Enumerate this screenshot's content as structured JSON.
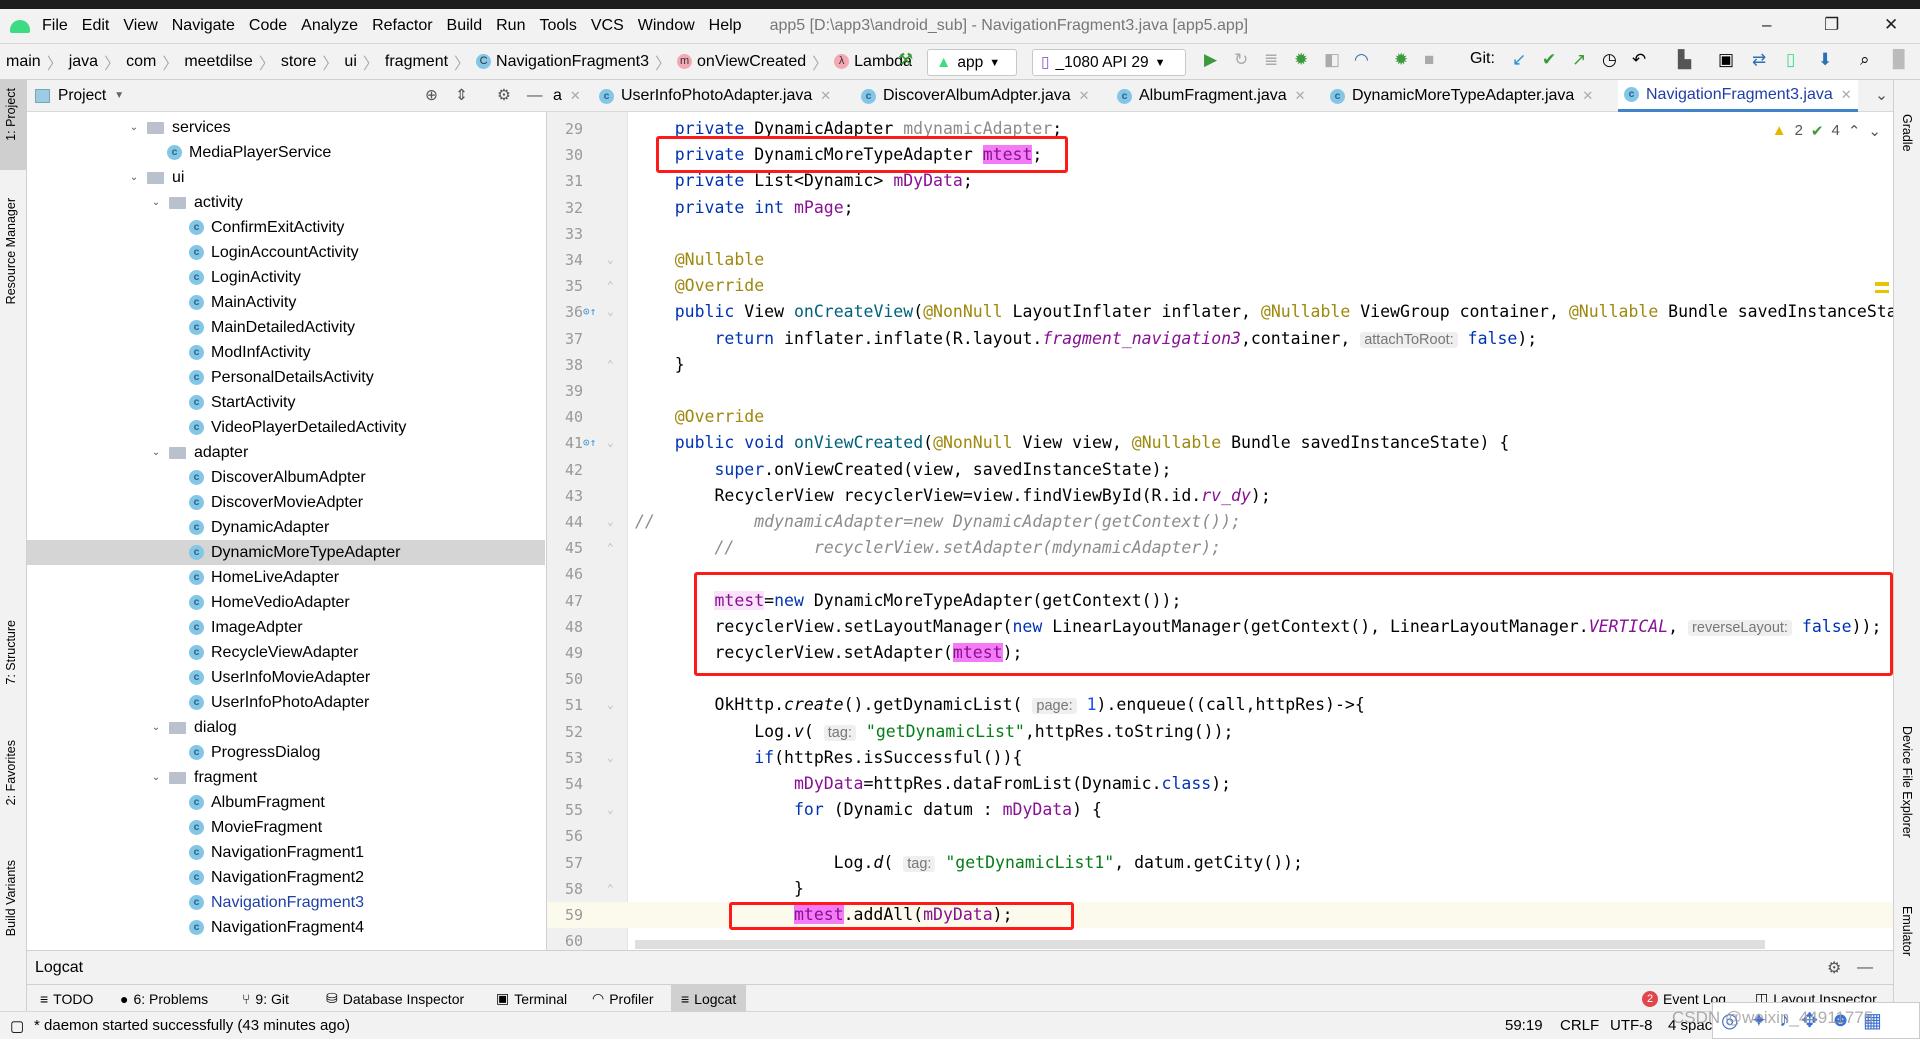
{
  "window": {
    "title": "app5 [D:\\app3\\android_sub] - NavigationFragment3.java [app5.app]",
    "minimize": "–",
    "maximize": "❐",
    "close": "✕"
  },
  "menu": [
    "File",
    "Edit",
    "View",
    "Navigate",
    "Code",
    "Analyze",
    "Refactor",
    "Build",
    "Run",
    "Tools",
    "VCS",
    "Window",
    "Help"
  ],
  "breadcrumb": [
    {
      "label": "main"
    },
    {
      "label": "java"
    },
    {
      "label": "com"
    },
    {
      "label": "meetdilse"
    },
    {
      "label": "store"
    },
    {
      "label": "ui"
    },
    {
      "label": "fragment"
    },
    {
      "label": "NavigationFragment3",
      "icon": "C"
    },
    {
      "label": "onViewCreated",
      "icon": "m"
    },
    {
      "label": "Lambda",
      "icon": "λ"
    }
  ],
  "toolbar": {
    "run_config": "app",
    "device": "_1080 API 29",
    "git_label": "Git:"
  },
  "left_strip": [
    "1: Project",
    "Resource Manager",
    "7: Structure",
    "2: Favorites",
    "Build Variants"
  ],
  "right_strip": [
    "Gradle",
    "Device File Explorer",
    "Emulator"
  ],
  "project": {
    "title": "Project",
    "tree": [
      {
        "label": "services",
        "depth": 0,
        "type": "folder"
      },
      {
        "label": "MediaPlayerService",
        "depth": 1,
        "type": "class"
      },
      {
        "label": "ui",
        "depth": 0,
        "type": "folder"
      },
      {
        "label": "activity",
        "depth": 1,
        "type": "folder"
      },
      {
        "label": "ConfirmExitActivity",
        "depth": 2,
        "type": "class"
      },
      {
        "label": "LoginAccountActivity",
        "depth": 2,
        "type": "class"
      },
      {
        "label": "LoginActivity",
        "depth": 2,
        "type": "class"
      },
      {
        "label": "MainActivity",
        "depth": 2,
        "type": "class"
      },
      {
        "label": "MainDetailedActivity",
        "depth": 2,
        "type": "class"
      },
      {
        "label": "ModInfActivity",
        "depth": 2,
        "type": "class"
      },
      {
        "label": "PersonalDetailsActivity",
        "depth": 2,
        "type": "class"
      },
      {
        "label": "StartActivity",
        "depth": 2,
        "type": "class"
      },
      {
        "label": "VideoPlayerDetailedActivity",
        "depth": 2,
        "type": "class"
      },
      {
        "label": "adapter",
        "depth": 1,
        "type": "folder"
      },
      {
        "label": "DiscoverAlbumAdpter",
        "depth": 2,
        "type": "class"
      },
      {
        "label": "DiscoverMovieAdpter",
        "depth": 2,
        "type": "class"
      },
      {
        "label": "DynamicAdapter",
        "depth": 2,
        "type": "class"
      },
      {
        "label": "DynamicMoreTypeAdapter",
        "depth": 2,
        "type": "class",
        "selected": true
      },
      {
        "label": "HomeLiveAdapter",
        "depth": 2,
        "type": "class"
      },
      {
        "label": "HomeVedioAdapter",
        "depth": 2,
        "type": "class"
      },
      {
        "label": "ImageAdpter",
        "depth": 2,
        "type": "class"
      },
      {
        "label": "RecycleViewAdapter",
        "depth": 2,
        "type": "class"
      },
      {
        "label": "UserInfoMovieAdapter",
        "depth": 2,
        "type": "class"
      },
      {
        "label": "UserInfoPhotoAdapter",
        "depth": 2,
        "type": "class"
      },
      {
        "label": "dialog",
        "depth": 1,
        "type": "folder"
      },
      {
        "label": "ProgressDialog",
        "depth": 2,
        "type": "class"
      },
      {
        "label": "fragment",
        "depth": 1,
        "type": "folder"
      },
      {
        "label": "AlbumFragment",
        "depth": 2,
        "type": "class"
      },
      {
        "label": "MovieFragment",
        "depth": 2,
        "type": "class"
      },
      {
        "label": "NavigationFragment1",
        "depth": 2,
        "type": "class"
      },
      {
        "label": "NavigationFragment2",
        "depth": 2,
        "type": "class"
      },
      {
        "label": "NavigationFragment3",
        "depth": 2,
        "type": "class",
        "open": true
      },
      {
        "label": "NavigationFragment4",
        "depth": 2,
        "type": "class"
      }
    ]
  },
  "tabs": [
    {
      "label": "a"
    },
    {
      "label": "UserInfoPhotoAdapter.java"
    },
    {
      "label": "DiscoverAlbumAdpter.java"
    },
    {
      "label": "AlbumFragment.java"
    },
    {
      "label": "DynamicMoreTypeAdapter.java"
    },
    {
      "label": "NavigationFragment3.java",
      "active": true
    }
  ],
  "inspections": {
    "warnings": "2",
    "typos": "4"
  },
  "code": [
    {
      "n": "29",
      "t": [
        [
          "",
          "    "
        ],
        [
          "kw",
          "private"
        ],
        [
          "",
          " DynamicAdapter "
        ],
        [
          "gray",
          "mdynamicAdapter"
        ],
        [
          "",
          ";"
        ]
      ]
    },
    {
      "n": "30",
      "t": [
        [
          "",
          "    "
        ],
        [
          "kw",
          "private"
        ],
        [
          "",
          " DynamicMoreTypeAdapter "
        ],
        [
          "hl",
          "mtest"
        ],
        [
          "",
          ";"
        ]
      ]
    },
    {
      "n": "31",
      "t": [
        [
          "",
          "    "
        ],
        [
          "kw",
          "private"
        ],
        [
          "",
          " List<Dynamic> "
        ],
        [
          "fld",
          "mDyData"
        ],
        [
          "",
          ";"
        ]
      ]
    },
    {
      "n": "32",
      "t": [
        [
          "",
          "    "
        ],
        [
          "kw",
          "private"
        ],
        [
          "",
          " "
        ],
        [
          "kw",
          "int"
        ],
        [
          "",
          " "
        ],
        [
          "fld",
          "mPage"
        ],
        [
          "",
          ";"
        ]
      ]
    },
    {
      "n": "33",
      "t": []
    },
    {
      "n": "34",
      "t": [
        [
          "",
          "    "
        ],
        [
          "ann",
          "@Nullable"
        ]
      ]
    },
    {
      "n": "35",
      "t": [
        [
          "",
          "    "
        ],
        [
          "ann",
          "@Override"
        ]
      ]
    },
    {
      "n": "36",
      "t": [
        [
          "",
          "    "
        ],
        [
          "kw",
          "public"
        ],
        [
          "",
          " View "
        ],
        [
          "fn",
          "onCreateView"
        ],
        [
          "",
          "("
        ],
        [
          "ann",
          "@NonNull"
        ],
        [
          "",
          " LayoutInflater inflater, "
        ],
        [
          "ann",
          "@Nullable"
        ],
        [
          "",
          " ViewGroup container, "
        ],
        [
          "ann",
          "@Nullable"
        ],
        [
          "",
          " Bundle savedInstanceState) {"
        ]
      ]
    },
    {
      "n": "37",
      "t": [
        [
          "",
          "        "
        ],
        [
          "kw",
          "return"
        ],
        [
          "",
          " inflater.inflate(R.layout."
        ],
        [
          "sfld",
          "fragment_navigation3"
        ],
        [
          "",
          ",container, "
        ],
        [
          "hint",
          "attachToRoot:"
        ],
        [
          "",
          " "
        ],
        [
          "kw",
          "false"
        ],
        [
          "",
          ");"
        ]
      ]
    },
    {
      "n": "38",
      "t": [
        [
          "",
          "    }"
        ]
      ]
    },
    {
      "n": "39",
      "t": []
    },
    {
      "n": "40",
      "t": [
        [
          "",
          "    "
        ],
        [
          "ann",
          "@Override"
        ]
      ]
    },
    {
      "n": "41",
      "t": [
        [
          "",
          "    "
        ],
        [
          "kw",
          "public"
        ],
        [
          "",
          " "
        ],
        [
          "kw",
          "void"
        ],
        [
          "",
          " "
        ],
        [
          "fn",
          "onViewCreated"
        ],
        [
          "",
          "("
        ],
        [
          "ann",
          "@NonNull"
        ],
        [
          "",
          " View view, "
        ],
        [
          "ann",
          "@Nullable"
        ],
        [
          "",
          " Bundle savedInstanceState) {"
        ]
      ]
    },
    {
      "n": "42",
      "t": [
        [
          "",
          "        "
        ],
        [
          "kw",
          "super"
        ],
        [
          "",
          ".onViewCreated(view, savedInstanceState);"
        ]
      ]
    },
    {
      "n": "43",
      "t": [
        [
          "",
          "        RecyclerView recyclerView=view.findViewById(R.id."
        ],
        [
          "sfld",
          "rv_dy"
        ],
        [
          "",
          ");"
        ]
      ]
    },
    {
      "n": "44",
      "t": [
        [
          "cmt",
          "//          mdynamicAdapter=new DynamicAdapter(getContext());"
        ]
      ]
    },
    {
      "n": "45",
      "t": [
        [
          "",
          "        "
        ],
        [
          "cmt",
          "//        recyclerView.setAdapter(mdynamicAdapter);"
        ]
      ]
    },
    {
      "n": "46",
      "t": []
    },
    {
      "n": "47",
      "t": [
        [
          "",
          "        "
        ],
        [
          "fld hl2",
          "mtest"
        ],
        [
          "",
          "="
        ],
        [
          "kw",
          "new"
        ],
        [
          "",
          " DynamicMoreTypeAdapter(getContext());"
        ]
      ]
    },
    {
      "n": "48",
      "t": [
        [
          "",
          "        recyclerView.setLayoutManager("
        ],
        [
          "kw",
          "new"
        ],
        [
          "",
          " LinearLayoutManager(getContext(), LinearLayoutManager."
        ],
        [
          "sfld",
          "VERTICAL"
        ],
        [
          "",
          ", "
        ],
        [
          "hint",
          "reverseLayout:"
        ],
        [
          "",
          " "
        ],
        [
          "kw",
          "false"
        ],
        [
          "",
          "));"
        ]
      ]
    },
    {
      "n": "49",
      "t": [
        [
          "",
          "        recyclerView.setAdapter("
        ],
        [
          "hl",
          "mtest"
        ],
        [
          "",
          ");"
        ]
      ]
    },
    {
      "n": "50",
      "t": []
    },
    {
      "n": "51",
      "t": [
        [
          "",
          "        OkHttp."
        ],
        [
          "ital",
          "create"
        ],
        [
          "",
          "().getDynamicList( "
        ],
        [
          "hint",
          "page:"
        ],
        [
          "",
          " "
        ],
        [
          "num",
          "1"
        ],
        [
          "",
          ").enqueue((call,httpRes)->{"
        ]
      ]
    },
    {
      "n": "52",
      "t": [
        [
          "",
          "            Log."
        ],
        [
          "ital",
          "v"
        ],
        [
          "",
          "( "
        ],
        [
          "hint",
          "tag:"
        ],
        [
          "",
          " "
        ],
        [
          "str",
          "\"getDynamicList\""
        ],
        [
          "",
          ",httpRes.toString());"
        ]
      ]
    },
    {
      "n": "53",
      "t": [
        [
          "",
          "            "
        ],
        [
          "kw",
          "if"
        ],
        [
          "",
          "(httpRes.isSuccessful()){"
        ]
      ]
    },
    {
      "n": "54",
      "t": [
        [
          "",
          "                "
        ],
        [
          "fld",
          "mDyData"
        ],
        [
          "",
          "=httpRes.dataFromList(Dynamic."
        ],
        [
          "kw",
          "class"
        ],
        [
          "",
          ");"
        ]
      ]
    },
    {
      "n": "55",
      "t": [
        [
          "",
          "                "
        ],
        [
          "kw",
          "for"
        ],
        [
          "",
          " (Dynamic datum : "
        ],
        [
          "fld",
          "mDyData"
        ],
        [
          "",
          ") {"
        ]
      ]
    },
    {
      "n": "56",
      "t": []
    },
    {
      "n": "57",
      "t": [
        [
          "",
          "                    Log."
        ],
        [
          "ital",
          "d"
        ],
        [
          "",
          "( "
        ],
        [
          "hint",
          "tag:"
        ],
        [
          "",
          " "
        ],
        [
          "str",
          "\"getDynamicList1\""
        ],
        [
          "",
          ", datum.getCity());"
        ]
      ]
    },
    {
      "n": "58",
      "t": [
        [
          "",
          "                }"
        ]
      ]
    },
    {
      "n": "59",
      "t": [
        [
          "",
          "                "
        ],
        [
          "hl",
          "mtest"
        ],
        [
          "",
          ".addAll("
        ],
        [
          "fld",
          "mDyData"
        ],
        [
          "",
          ");"
        ]
      ],
      "current": true
    },
    {
      "n": "60",
      "t": []
    }
  ],
  "logcat": {
    "title": "Logcat"
  },
  "tool_tabs": [
    {
      "label": "TODO",
      "icon": "≡"
    },
    {
      "label": "6: Problems",
      "icon": "●"
    },
    {
      "label": "9: Git",
      "icon": "⑂"
    },
    {
      "label": "Database Inspector",
      "icon": "⛁"
    },
    {
      "label": "Terminal",
      "icon": "▣"
    },
    {
      "label": "Profiler",
      "icon": "◠"
    },
    {
      "label": "Logcat",
      "icon": "≡",
      "active": true
    }
  ],
  "right_tool_tabs": {
    "event_log": "Event Log",
    "event_count": "2",
    "layout_inspector": "Layout Inspector"
  },
  "status": {
    "message": "* daemon started successfully (43 minutes ago)",
    "position": "59:19",
    "line_sep": "CRLF",
    "encoding": "UTF-8",
    "indent": "4 spac"
  },
  "watermark": "CSDN @weixin_44911775",
  "colors": {
    "highlight_box": "#ff1a1a",
    "keyword": "#0033b3",
    "field": "#871094",
    "annotation": "#9e880d",
    "string": "#067d17",
    "usage_highlight": "#f57af5"
  }
}
